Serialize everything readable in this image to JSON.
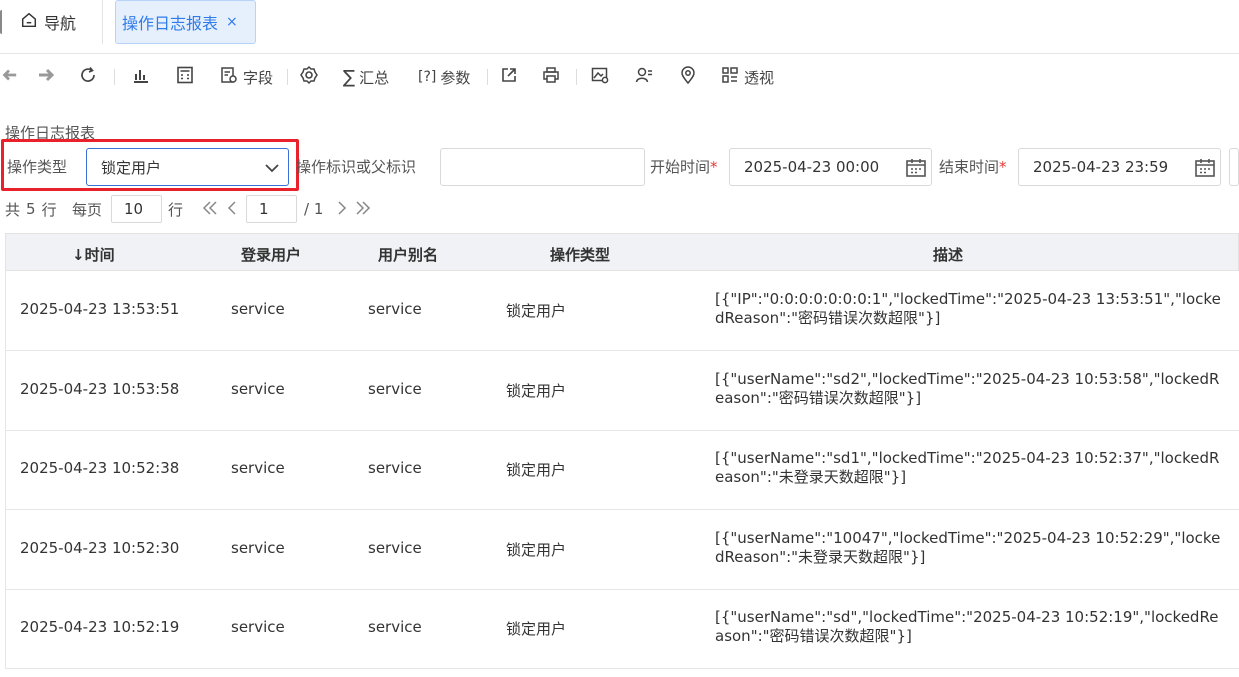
{
  "tabs": {
    "nav_label": "导航",
    "active_label": "操作日志报表",
    "close_glyph": "×"
  },
  "toolbar": {
    "field_label": "字段",
    "sum_label": "汇总",
    "param_label": "参数",
    "pivot_label": "透视"
  },
  "report": {
    "title": "操作日志报表"
  },
  "filters": {
    "op_type_label": "操作类型",
    "op_type_value": "锁定用户",
    "op_flag_label": "操作标识或父标识",
    "op_flag_value": "",
    "start_label": "开始时间",
    "start_value": "2025-04-23 00:00",
    "end_label": "结束时间",
    "end_value": "2025-04-23 23:59",
    "required_mark": "*"
  },
  "pager": {
    "total_prefix": "共",
    "total": "5",
    "total_suffix": "行",
    "per_page_label": "每页",
    "per_page": "10",
    "per_page_suffix": "行",
    "current_page": "1",
    "total_pages": "/ 1"
  },
  "table": {
    "columns": [
      "↓时间",
      "登录用户",
      "用户别名",
      "操作类型",
      "描述"
    ],
    "rows": [
      {
        "time": "2025-04-23 13:53:51",
        "user": "service",
        "alias": "service",
        "op": "锁定用户",
        "desc": "[{\"IP\":\"0:0:0:0:0:0:0:1\",\"lockedTime\":\"2025-04-23 13:53:51\",\"lockedReason\":\"密码错误次数超限\"}]"
      },
      {
        "time": "2025-04-23 10:53:58",
        "user": "service",
        "alias": "service",
        "op": "锁定用户",
        "desc": "[{\"userName\":\"sd2\",\"lockedTime\":\"2025-04-23 10:53:58\",\"lockedReason\":\"密码错误次数超限\"}]"
      },
      {
        "time": "2025-04-23 10:52:38",
        "user": "service",
        "alias": "service",
        "op": "锁定用户",
        "desc": "[{\"userName\":\"sd1\",\"lockedTime\":\"2025-04-23 10:52:37\",\"lockedReason\":\"未登录天数超限\"}]"
      },
      {
        "time": "2025-04-23 10:52:30",
        "user": "service",
        "alias": "service",
        "op": "锁定用户",
        "desc": "[{\"userName\":\"10047\",\"lockedTime\":\"2025-04-23 10:52:29\",\"lockedReason\":\"未登录天数超限\"}]"
      },
      {
        "time": "2025-04-23 10:52:19",
        "user": "service",
        "alias": "service",
        "op": "锁定用户",
        "desc": "[{\"userName\":\"sd\",\"lockedTime\":\"2025-04-23 10:52:19\",\"lockedReason\":\"密码错误次数超限\"}]"
      }
    ]
  },
  "colors": {
    "accent": "#2f7bea",
    "highlight_border": "#e8212a",
    "header_bg": "#f0f2f5"
  }
}
